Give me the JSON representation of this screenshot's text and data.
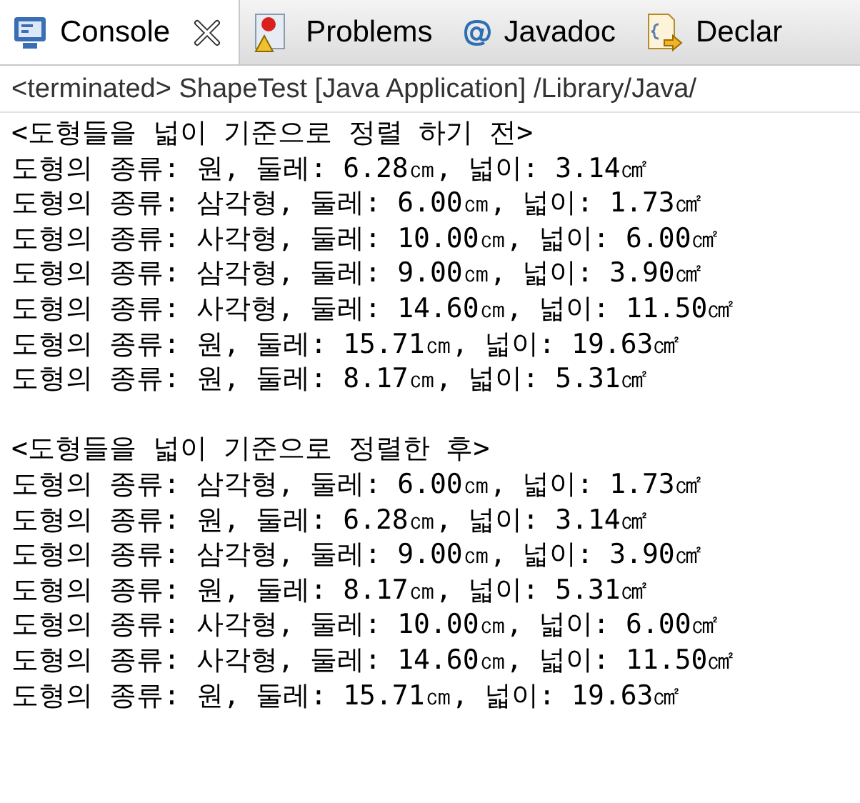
{
  "tabs": [
    {
      "label": "Console",
      "kind": "console",
      "selected": true
    },
    {
      "label": "Problems",
      "kind": "problems",
      "selected": false
    },
    {
      "label": "Javadoc",
      "kind": "javadoc",
      "selected": false
    },
    {
      "label": "Declar",
      "kind": "declaration",
      "selected": false
    }
  ],
  "console": {
    "header": "<terminated> ShapeTest [Java Application] /Library/Java/",
    "blocks": [
      {
        "lines": [
          "<도형들을 넓이 기준으로 정렬 하기 전>",
          "도형의 종류: 원, 둘레: 6.28㎝, 넓이: 3.14㎠",
          "도형의 종류: 삼각형, 둘레: 6.00㎝, 넓이: 1.73㎠",
          "도형의 종류: 사각형, 둘레: 10.00㎝, 넓이: 6.00㎠",
          "도형의 종류: 삼각형, 둘레: 9.00㎝, 넓이: 3.90㎠",
          "도형의 종류: 사각형, 둘레: 14.60㎝, 넓이: 11.50㎠",
          "도형의 종류: 원, 둘레: 15.71㎝, 넓이: 19.63㎠",
          "도형의 종류: 원, 둘레: 8.17㎝, 넓이: 5.31㎠"
        ]
      },
      {
        "lines": [
          "<도형들을 넓이 기준으로 정렬한 후>",
          "도형의 종류: 삼각형, 둘레: 6.00㎝, 넓이: 1.73㎠",
          "도형의 종류: 원, 둘레: 6.28㎝, 넓이: 3.14㎠",
          "도형의 종류: 삼각형, 둘레: 9.00㎝, 넓이: 3.90㎠",
          "도형의 종류: 원, 둘레: 8.17㎝, 넓이: 5.31㎠",
          "도형의 종류: 사각형, 둘레: 10.00㎝, 넓이: 6.00㎠",
          "도형의 종류: 사각형, 둘레: 14.60㎝, 넓이: 11.50㎠",
          "도형의 종류: 원, 둘레: 15.71㎝, 넓이: 19.63㎠"
        ]
      }
    ]
  }
}
